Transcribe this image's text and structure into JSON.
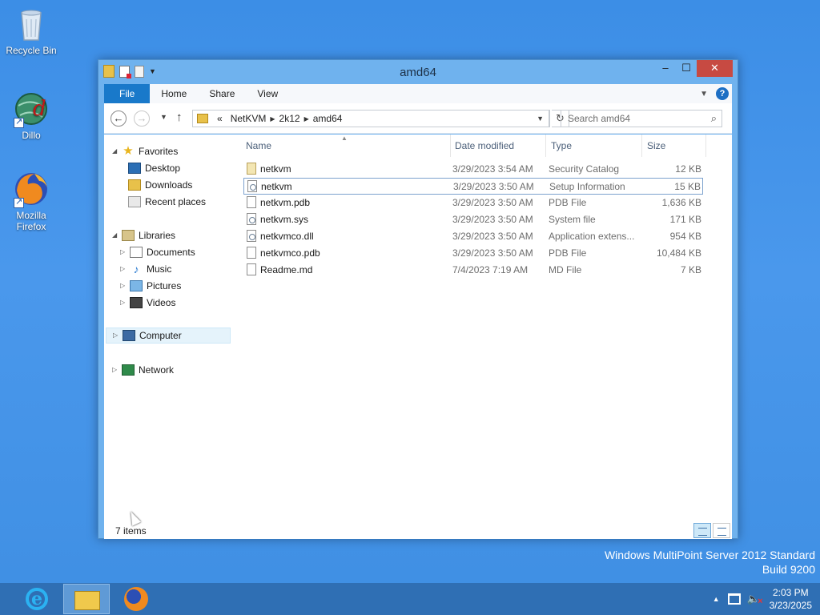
{
  "desktop": {
    "icons": [
      {
        "label": "Recycle Bin"
      },
      {
        "label": "Dillo"
      },
      {
        "label": "Mozilla Firefox"
      }
    ],
    "watermark": {
      "line1": "Windows MultiPoint Server 2012 Standard",
      "line2": "Build 9200"
    }
  },
  "window": {
    "title": "amd64",
    "controls": {
      "minimize": "–",
      "maximize": "☐",
      "close": "✕"
    },
    "ribbon_tabs": [
      {
        "label": "File"
      },
      {
        "label": "Home"
      },
      {
        "label": "Share"
      },
      {
        "label": "View"
      }
    ],
    "address": {
      "prefix": "«",
      "crumbs": [
        "NetKVM",
        "2k12",
        "amd64"
      ]
    },
    "search": {
      "placeholder": "Search amd64"
    },
    "nav": {
      "favorites": {
        "label": "Favorites",
        "items": [
          "Desktop",
          "Downloads",
          "Recent places"
        ]
      },
      "libraries": {
        "label": "Libraries",
        "items": [
          "Documents",
          "Music",
          "Pictures",
          "Videos"
        ]
      },
      "computer": {
        "label": "Computer"
      },
      "network": {
        "label": "Network"
      }
    },
    "columns": {
      "name": "Name",
      "date": "Date modified",
      "type": "Type",
      "size": "Size"
    },
    "files": [
      {
        "name": "netkvm",
        "date": "3/29/2023 3:54 AM",
        "type": "Security Catalog",
        "size": "12 KB",
        "icon": "catalog-file-icon"
      },
      {
        "name": "netkvm",
        "date": "3/29/2023 3:50 AM",
        "type": "Setup Information",
        "size": "15 KB",
        "icon": "setup-file-icon"
      },
      {
        "name": "netkvm.pdb",
        "date": "3/29/2023 3:50 AM",
        "type": "PDB File",
        "size": "1,636 KB",
        "icon": "file-icon"
      },
      {
        "name": "netkvm.sys",
        "date": "3/29/2023 3:50 AM",
        "type": "System file",
        "size": "171 KB",
        "icon": "system-file-icon"
      },
      {
        "name": "netkvmco.dll",
        "date": "3/29/2023 3:50 AM",
        "type": "Application extens...",
        "size": "954 KB",
        "icon": "dll-file-icon"
      },
      {
        "name": "netkvmco.pdb",
        "date": "3/29/2023 3:50 AM",
        "type": "PDB File",
        "size": "10,484 KB",
        "icon": "file-icon"
      },
      {
        "name": "Readme.md",
        "date": "7/4/2023 7:19 AM",
        "type": "MD File",
        "size": "7 KB",
        "icon": "file-icon"
      }
    ],
    "status": {
      "count": "7 items"
    }
  },
  "taskbar": {
    "clock": {
      "time": "2:03 PM",
      "date": "3/23/2025"
    }
  }
}
